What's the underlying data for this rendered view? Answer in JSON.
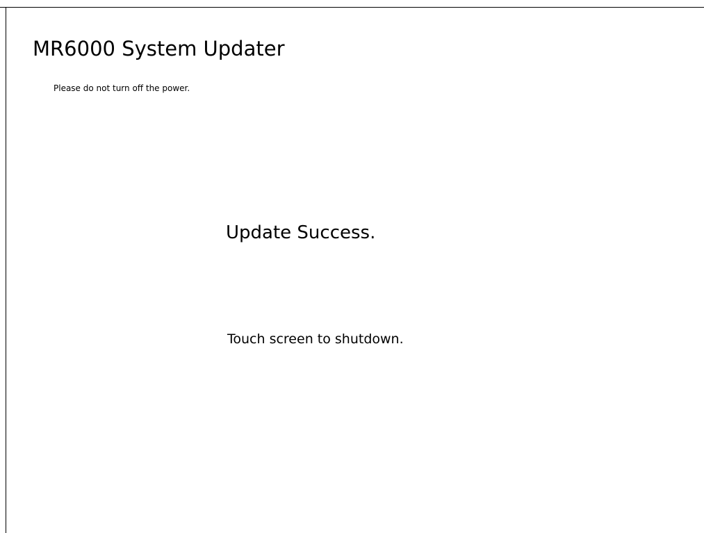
{
  "header": {
    "title": "MR6000 System Updater",
    "warning": "Please do not turn off the power."
  },
  "main": {
    "status": "Update Success.",
    "instruction": "Touch screen to shutdown."
  },
  "colors": {
    "background": "#ffffff",
    "text": "#000000",
    "frame": "#000000"
  }
}
